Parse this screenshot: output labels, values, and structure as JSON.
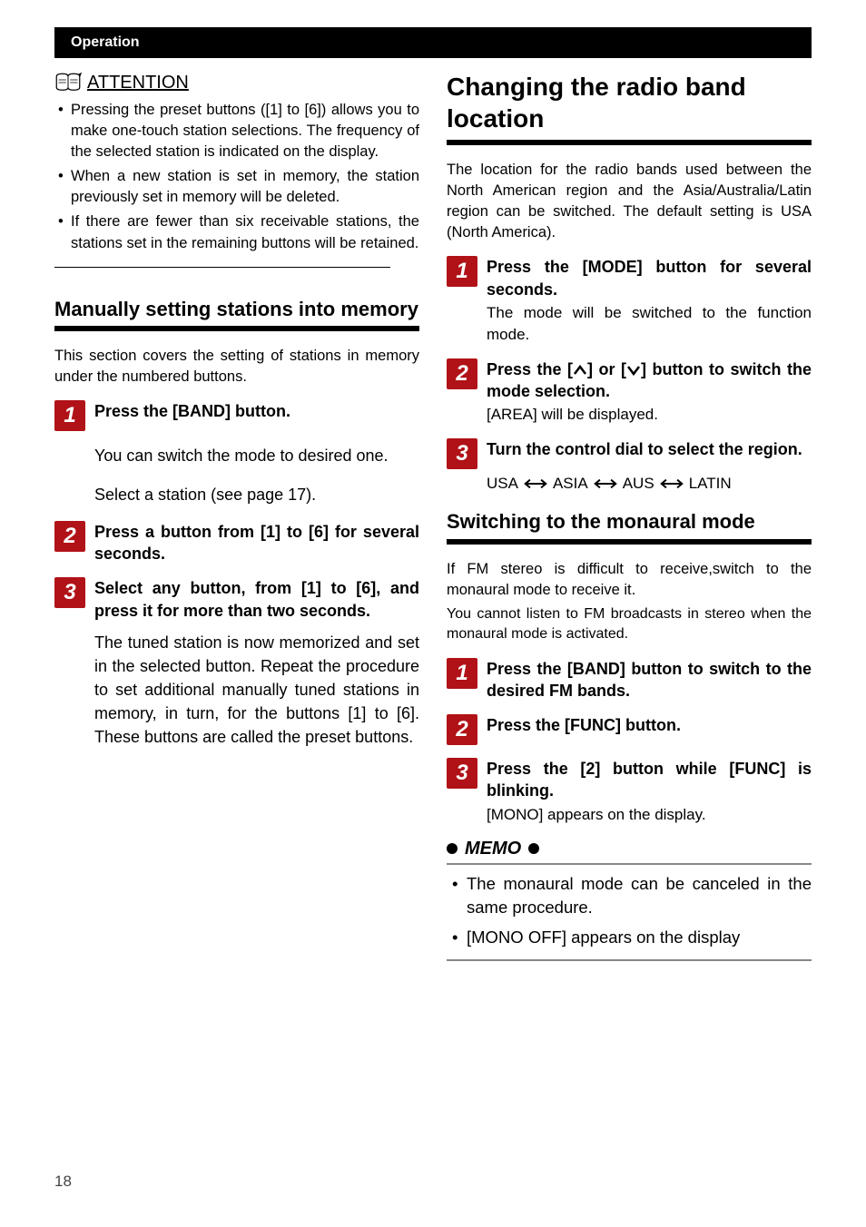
{
  "header": {
    "section": "Operation"
  },
  "left": {
    "attention": {
      "label": "ATTENTION",
      "bullets": [
        "Pressing the preset buttons ([1] to [6]) allows you to make one-touch station selections. The frequency of the selected station is indicated on the display.",
        "When a new station is set in memory, the station previously set in memory will be deleted.",
        "If there are fewer than six receivable stations, the stations set in the remaining buttons will be retained."
      ]
    },
    "manual": {
      "heading": "Manually setting stations into memory",
      "intro": "This section covers the setting of stations in memory under the numbered buttons.",
      "steps": [
        {
          "num": "1",
          "title": "Press the [BAND] button.",
          "text1": "You can switch the mode to desired one.",
          "text2": "Select a station (see page 17)."
        },
        {
          "num": "2",
          "title": "Press a button from [1] to [6] for several seconds."
        },
        {
          "num": "3",
          "title": "Select any button, from [1] to [6], and press it for more than two seconds.",
          "text1": "The tuned station is now memorized and set in the selected button. Repeat the procedure to set additional manually tuned stations in memory, in turn, for the buttons [1] to [6]. These buttons are called the preset buttons."
        }
      ]
    }
  },
  "right": {
    "change": {
      "heading": "Changing the radio band location",
      "intro": "The location for the radio bands used between the North American region and the Asia/Australia/Latin region can be switched. The default setting is USA (North America).",
      "steps": [
        {
          "num": "1",
          "title": "Press the [MODE] button for several seconds.",
          "sub": "The mode will be switched to the function mode."
        },
        {
          "num": "2",
          "title_pre": "Press the [",
          "title_mid": "] or [",
          "title_post": "] button to switch the mode selection.",
          "sub": "[AREA] will be displayed."
        },
        {
          "num": "3",
          "title": "Turn the control dial to select the region.",
          "regions": [
            "USA",
            "ASIA",
            "AUS",
            "LATIN"
          ]
        }
      ]
    },
    "mono": {
      "heading": "Switching to the monaural mode",
      "intro1": "If FM stereo is difficult to receive,switch to the monaural mode to receive it.",
      "intro2": "You cannot listen to FM broadcasts in stereo when the monaural mode is activated.",
      "steps": [
        {
          "num": "1",
          "title": "Press the [BAND] button to switch to the desired FM bands."
        },
        {
          "num": "2",
          "title": "Press the [FUNC] button."
        },
        {
          "num": "3",
          "title": "Press the [2] button while [FUNC] is blinking.",
          "sub": "[MONO] appears on the display."
        }
      ],
      "memo": {
        "label": "MEMO",
        "bullets": [
          "The monaural mode can be canceled in the same procedure.",
          "[MONO OFF] appears on the display"
        ]
      }
    }
  },
  "page_number": "18"
}
